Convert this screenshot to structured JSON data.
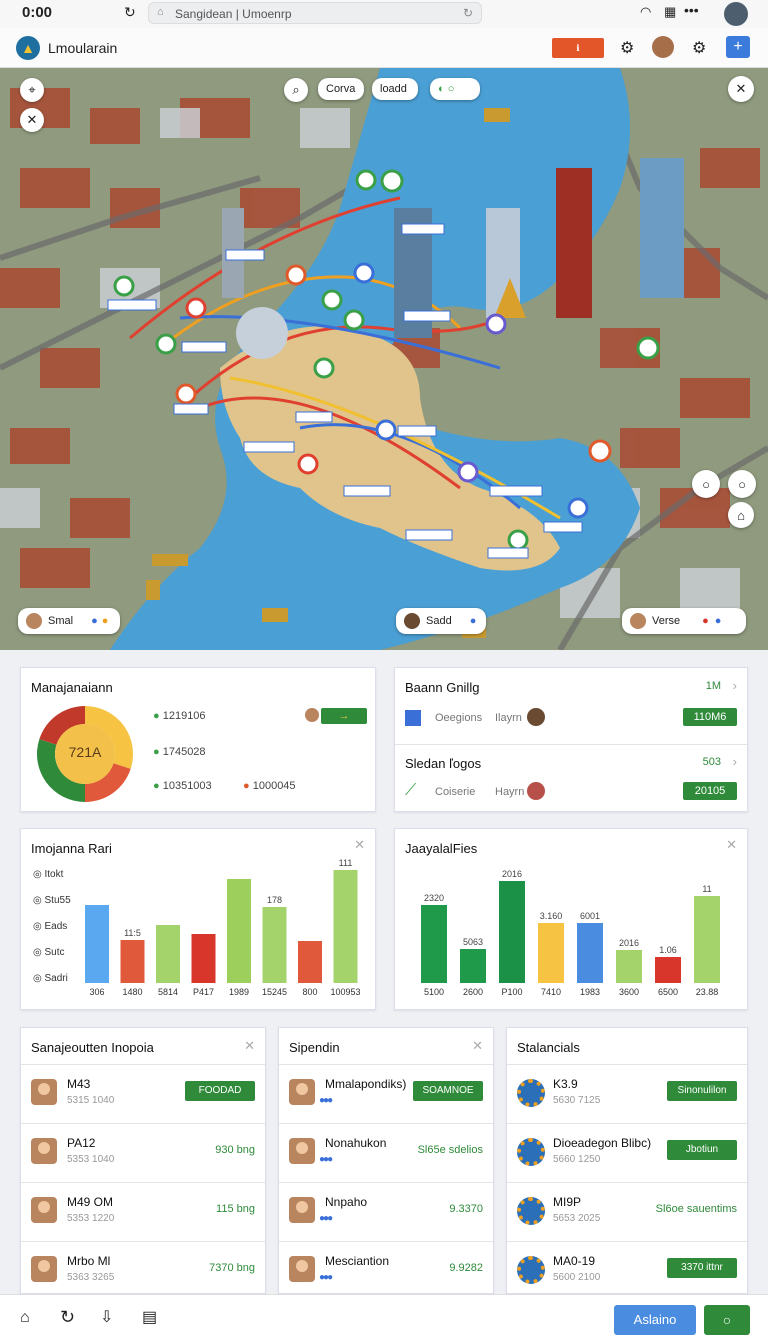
{
  "status": {
    "time": "0:00",
    "url": "Sangidean | Umoenrp"
  },
  "header": {
    "title": "Lmoularain",
    "badge": "ℹ"
  },
  "map": {
    "pills": {
      "left": "Corva",
      "mid": "loadd"
    },
    "chips": {
      "a": "Smal",
      "b": "Sadd",
      "c": "Verse"
    }
  },
  "card1": {
    "title": "Manajanaiann",
    "donut_value": "721A",
    "donut_shares": [
      30,
      20,
      30,
      20
    ],
    "stats": [
      "1219106",
      "1745028",
      "10351003",
      "1000045"
    ]
  },
  "card2": {
    "title": "Baann Gnillg",
    "title_meta": "1M",
    "row1_a": "Oeegions",
    "row1_b": "Ilayrn",
    "row1_btn": "110M6",
    "title2": "Sledan ľogos",
    "title2_meta": "503",
    "row2_a": "Coiserie",
    "row2_b": "Hayrn",
    "row2_btn": "20105"
  },
  "chart1": {
    "title": "Imojanna Rari",
    "legend": [
      "Itokt",
      "Stu55",
      "Eads",
      "Sutc",
      "Sadri"
    ],
    "chart_data": {
      "type": "bar",
      "categories": [
        "306",
        "1480",
        "5814",
        "P417",
        "1989",
        "15245",
        "800",
        "100953"
      ],
      "values": [
        78,
        43,
        58,
        49,
        104,
        76,
        42,
        113
      ],
      "value_labels": [
        "",
        "11:5",
        "",
        "",
        "",
        "178",
        "",
        "111"
      ],
      "colors": [
        "#5aa9f0",
        "#e0593a",
        "#a5d36b",
        "#d9362b",
        "#9ccf5c",
        "#a5d36b",
        "#e0593a",
        "#a5d36b"
      ]
    }
  },
  "chart2": {
    "title": "JaayalalFies",
    "chart_data": {
      "type": "bar",
      "categories": [
        "5100",
        "2600",
        "P100",
        "7410",
        "1983",
        "3600",
        "6500",
        "23.88"
      ],
      "values": [
        78,
        34,
        102,
        60,
        60,
        33,
        26,
        87
      ],
      "value_labels": [
        "2320",
        "5063",
        "2016",
        "3.160",
        "6001",
        "2016",
        "1.06",
        "11"
      ],
      "colors": [
        "#1f9a4a",
        "#1f9a4a",
        "#1a9147",
        "#f6c342",
        "#4a8de0",
        "#a5d36b",
        "#d9362b",
        "#a5d36b"
      ]
    }
  },
  "list1": {
    "title": "Sanajeoutten Inopoia",
    "items": [
      {
        "name": "M43",
        "sub": "5315 1040",
        "value": "FOODAD"
      },
      {
        "name": "PA12",
        "sub": "5353 1040",
        "value": "930 bng"
      },
      {
        "name": "M49 OM",
        "sub": "5353 1220",
        "value": "115 bng"
      },
      {
        "name": "Mrbo Ml",
        "sub": "5363 3265",
        "value": "7370 bng"
      }
    ]
  },
  "list2": {
    "title": "Sipendin",
    "items": [
      {
        "name": "Mmalapondiks)",
        "sub": "",
        "value": "SOAMNOE"
      },
      {
        "name": "Nonahukon",
        "sub": "",
        "value": "Sl65e sdelios"
      },
      {
        "name": "Nnpaho",
        "sub": "",
        "value": "9.3370"
      },
      {
        "name": "Mesciantion",
        "sub": "",
        "value": "9.9282"
      }
    ]
  },
  "list3": {
    "title": "Stalancials",
    "items": [
      {
        "name": "K3.9",
        "sub": "5630 7125",
        "value": "Sinonulilon"
      },
      {
        "name": "Dioeadegon Blibc)",
        "sub": "5660 1250",
        "value": "Jbotiun"
      },
      {
        "name": "MI9P",
        "sub": "5653 2025",
        "value": "Sl6oe sauentims"
      },
      {
        "name": "MA0-19",
        "sub": "5600 2100",
        "value": "3370 ittnr"
      }
    ]
  },
  "bottom": {
    "primary": "Aslaino",
    "secondary": "○"
  }
}
